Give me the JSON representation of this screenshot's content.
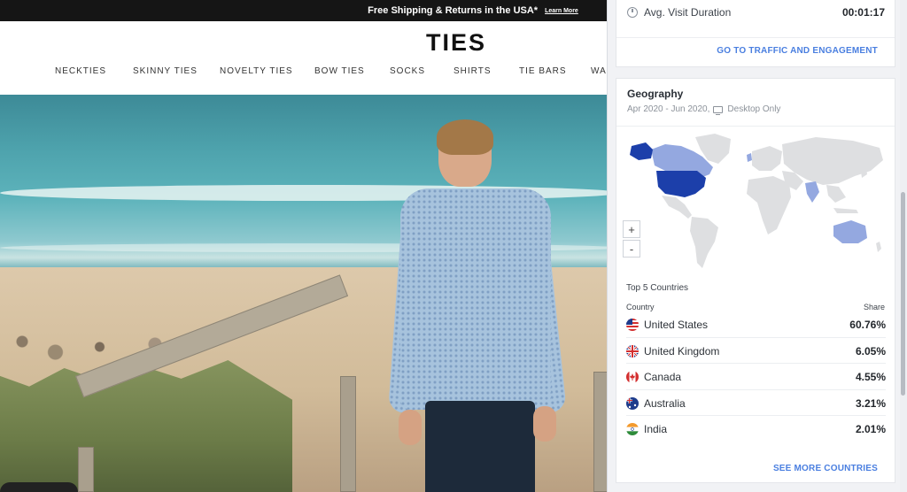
{
  "promo": {
    "text": "Free Shipping & Returns in the USA*",
    "link": "Learn More"
  },
  "store": {
    "logo": "TIES",
    "nav": [
      "NECKTIES",
      "SKINNY TIES",
      "NOVELTY TIES",
      "BOW TIES",
      "SOCKS",
      "SHIRTS",
      "TIE BARS",
      "WAL"
    ]
  },
  "panel": {
    "engagement": {
      "label": "Avg. Visit Duration",
      "value": "00:01:17",
      "link": "GO TO TRAFFIC AND ENGAGEMENT",
      "icon": "clock-icon"
    },
    "geography": {
      "title": "Geography",
      "date_range": "Apr 2020 - Jun 2020,",
      "device": "Desktop Only",
      "device_icon": "desktop-icon",
      "zoom_in": "+",
      "zoom_out": "-",
      "map_colors": {
        "high": "#1c3faa",
        "mid": "#94a8e0",
        "none": "#dedfe1"
      },
      "top_title": "Top 5 Countries",
      "col_country": "Country",
      "col_share": "Share",
      "countries": [
        {
          "name": "United States",
          "share": "60.76%",
          "flag": "us-flag-icon"
        },
        {
          "name": "United Kingdom",
          "share": "6.05%",
          "flag": "uk-flag-icon"
        },
        {
          "name": "Canada",
          "share": "4.55%",
          "flag": "canada-flag-icon"
        },
        {
          "name": "Australia",
          "share": "3.21%",
          "flag": "australia-flag-icon"
        },
        {
          "name": "India",
          "share": "2.01%",
          "flag": "india-flag-icon"
        }
      ],
      "more_link": "SEE MORE COUNTRIES"
    }
  }
}
